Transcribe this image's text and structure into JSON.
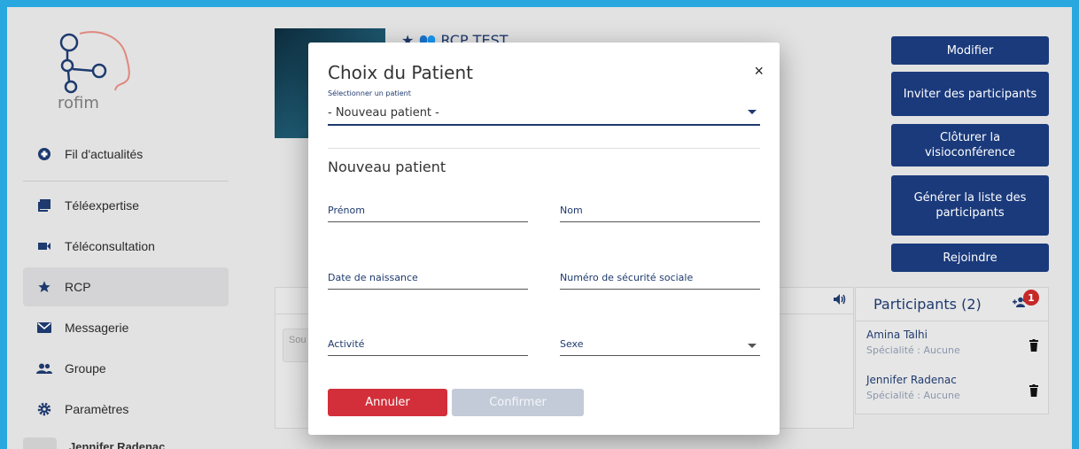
{
  "sidebar": {
    "logo_text": "rofim",
    "items": [
      {
        "label": "Fil d'actualités",
        "icon": "news-icon"
      },
      {
        "label": "Téléexpertise",
        "icon": "book-icon"
      },
      {
        "label": "Téléconsultation",
        "icon": "video-icon"
      },
      {
        "label": "RCP",
        "icon": "star-icon"
      },
      {
        "label": "Messagerie",
        "icon": "mail-icon"
      },
      {
        "label": "Groupe",
        "icon": "group-icon"
      },
      {
        "label": "Paramètres",
        "icon": "gear-icon"
      }
    ],
    "user_name": "Jennifer Radenac"
  },
  "header": {
    "title": "RCP TEST"
  },
  "actions": {
    "modifier": "Modifier",
    "inviter": "Inviter des participants",
    "cloturer": "Clôturer la visioconférence",
    "generer": "Générer la liste des participants",
    "rejoindre": "Rejoindre"
  },
  "panel": {
    "chip_text": "Sou"
  },
  "participants": {
    "title": "Participants (2)",
    "badge": "1",
    "list": [
      {
        "name": "Amina Talhi",
        "specialty": "Spécialité : Aucune"
      },
      {
        "name": "Jennifer Radenac",
        "specialty": "Spécialité : Aucune"
      }
    ]
  },
  "modal": {
    "title": "Choix du Patient",
    "close": "×",
    "select_label": "Sélectionner un patient",
    "select_value": "- Nouveau patient -",
    "subtitle": "Nouveau patient",
    "fields": {
      "prenom": "Prénom",
      "nom": "Nom",
      "date_naissance": "Date de naissance",
      "securite_sociale": "Numéro de sécurité sociale",
      "activite": "Activité",
      "sexe": "Sexe"
    },
    "cancel": "Annuler",
    "confirm": "Confirmer"
  },
  "colors": {
    "primary": "#1a3a7c",
    "danger": "#d22f3a",
    "disabled": "#c3cbd8",
    "frame": "#29a8e0"
  }
}
